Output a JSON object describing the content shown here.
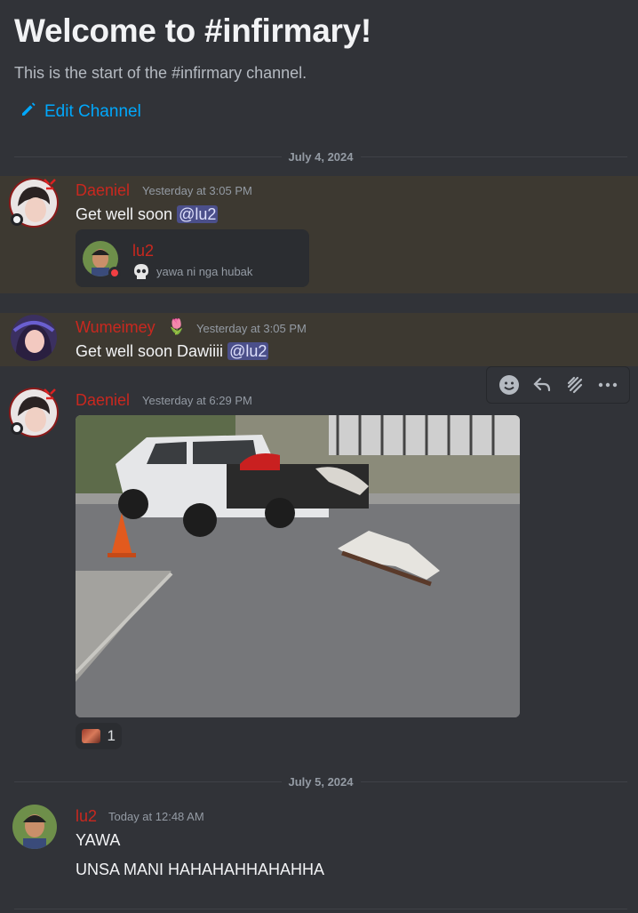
{
  "welcome": {
    "title": "Welcome to #infirmary!",
    "subtitle": "This is the start of the #infirmary channel.",
    "edit_label": "Edit Channel"
  },
  "dates": [
    "July 4, 2024",
    "July 5, 2024"
  ],
  "messages": [
    {
      "author": "Daeniel",
      "time": "Yesterday at 3:05 PM",
      "text": "Get well soon ",
      "mention": "@lu2",
      "embed": {
        "user": "lu2",
        "status_text": "yawa ni nga hubak"
      }
    },
    {
      "author": "Wumeimey",
      "time": "Yesterday at 3:05 PM",
      "text": "Get well soon Dawiiii ",
      "mention": "@lu2",
      "badge_emoji": "🌷"
    },
    {
      "author": "Daeniel",
      "time": "Yesterday at 6:29 PM",
      "reaction_count": "1"
    },
    {
      "author": "lu2",
      "time": "Today at 12:48 AM",
      "lines": [
        "YAWA",
        "UNSA MANI HAHAHAHHAHAHHA"
      ]
    }
  ],
  "colors": {
    "background": "#313338",
    "highlight": "#3d3931",
    "username": "#c9281f",
    "mention_bg": "#4b4f8a",
    "link": "#00a8fc"
  }
}
